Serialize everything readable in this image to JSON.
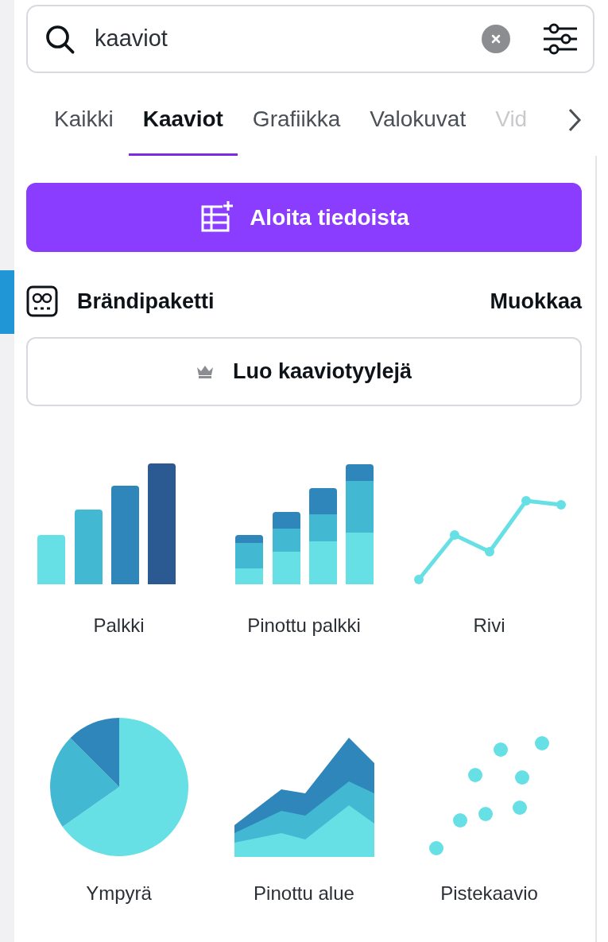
{
  "search": {
    "value": "kaaviot"
  },
  "tabs": [
    {
      "label": "Kaikki",
      "selected": false
    },
    {
      "label": "Kaaviot",
      "selected": true
    },
    {
      "label": "Grafiikka",
      "selected": false
    },
    {
      "label": "Valokuvat",
      "selected": false
    },
    {
      "label": "Vid",
      "selected": false
    }
  ],
  "primary_button": {
    "label": "Aloita tiedoista"
  },
  "brand_kit": {
    "title": "Brändipaketti",
    "edit_link": "Muokkaa"
  },
  "create_styles_button": {
    "label": "Luo kaaviotyylejä"
  },
  "chart_types": [
    {
      "label": "Palkki",
      "kind": "bar"
    },
    {
      "label": "Pinottu palkki",
      "kind": "stacked_bar"
    },
    {
      "label": "Rivi",
      "kind": "line"
    },
    {
      "label": "Ympyrä",
      "kind": "pie"
    },
    {
      "label": "Pinottu alue",
      "kind": "stacked_area"
    },
    {
      "label": "Pistekaavio",
      "kind": "scatter"
    }
  ]
}
